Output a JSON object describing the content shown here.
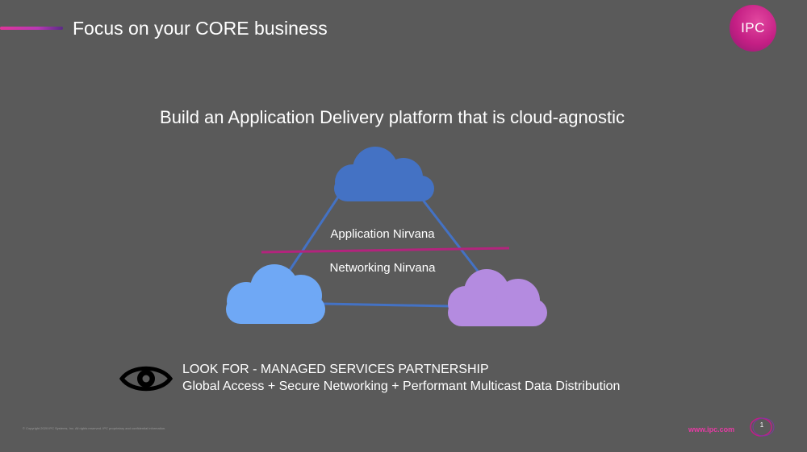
{
  "slide": {
    "title": "Focus on your CORE business",
    "logo_text": "IPC",
    "headline": "Build an Application Delivery platform that is cloud-agnostic",
    "diagram": {
      "upper_label": "Application Nirvana",
      "lower_label": "Networking Nirvana",
      "clouds": [
        {
          "name": "top",
          "color": "#4472c4"
        },
        {
          "name": "bottom-left",
          "color": "#6fa8f5"
        },
        {
          "name": "bottom-right",
          "color": "#b48be0"
        }
      ],
      "connector_color": "#4472c4",
      "divider_color": "#b3247d"
    },
    "look_for": "LOOK FOR - MANAGED SERVICES PARTNERSHIP",
    "access_line": "Global Access + Secure Networking + Performant Multicast Data Distribution",
    "eye_icon": "eye-icon",
    "copyright": "© Copyright 2020 IPC Systems, Inc. All rights reserved. IPC proprietary and confidential information.",
    "website": "www.ipc.com",
    "page_number": "1"
  },
  "colors": {
    "background": "#5a5a5a",
    "accent_pink": "#e0359a",
    "accent_purple": "#5b2a86",
    "logo": "#c41e84",
    "website": "#e83aa5"
  }
}
